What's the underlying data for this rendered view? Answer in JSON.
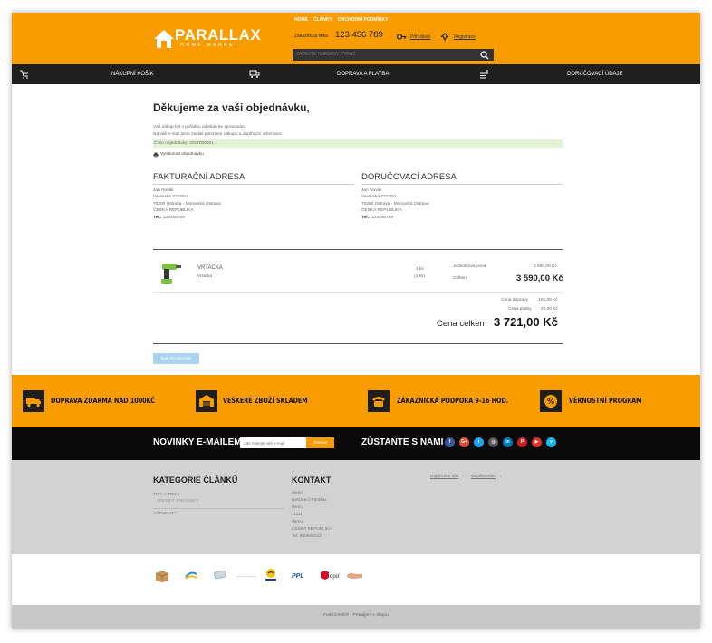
{
  "header": {
    "logo_title": "PARALLAX",
    "logo_subtitle": "HOME MARKET",
    "nav": [
      "HOME",
      "ČLÁNKY",
      "OBCHODNÍ PODMÍNKY"
    ],
    "phone_label": "Zákaznická linka",
    "phone_number": "123 456 789",
    "login": "Přihlášení",
    "register": "Registrace",
    "search_placeholder": "ZADEJTE HLEDANÝ VÝRAZ",
    "accent_color": "#f99c00"
  },
  "steps": [
    "NÁKUPNÍ KOŠÍK",
    "DOPRAVA A PLATBA",
    "DORUČOVACÍ ÚDAJE"
  ],
  "order": {
    "title": "Děkujeme za vaši objednávku,",
    "line1": "Váš nákup byl v pořádku odeslán ke zpracování.",
    "line2": "Na váš e-mail jsme zaslali potvrzení nákupu a doplňující informace.",
    "order_number": "Číslo objednávky: 2017000001",
    "print": "Vytisknout objednávku"
  },
  "billing": {
    "title": "FAKTURAČNÍ ADRESA",
    "name": "Jan Novák",
    "street": "Varenská 2723/51",
    "city": "70200 Ostrava - Moravská Ostrava",
    "country": "ČESKÁ REPUBLIKA",
    "phone_label": "Tel.:",
    "phone": "123456789"
  },
  "delivery": {
    "title": "DORUČOVACÍ ADRESA",
    "name": "Jan Novák",
    "street": "Varenská 2723/51",
    "city": "70200 Ostrava - Moravská Ostrava",
    "country": "ČESKÁ REPUBLIKA",
    "phone_label": "Tel.:",
    "phone": "123456789"
  },
  "item": {
    "name": "VRTAČKA",
    "variant": "Vrtačka",
    "qty": "1 ks",
    "qty_sub": "(1 ks)",
    "unit_label": "Jednotková cena",
    "unit_price": "3 590,00 Kč",
    "total_label": "Celkem",
    "total_price": "3 590,00 Kč"
  },
  "summary": {
    "shipping_label": "Cena dopravy",
    "shipping": "105,00 Kč",
    "payment_label": "Cena platby",
    "payment": "26,00 Kč",
    "grand_label": "Cena celkem",
    "grand": "3 721,00 Kč"
  },
  "back_button": "Zpět do obchodu",
  "features": [
    {
      "icon": "truck-icon",
      "text": "DOPRAVA ZDARMA NAD 1000KČ"
    },
    {
      "icon": "warehouse-icon",
      "text": "VEŠKERÉ ZBOŽÍ SKLADEM"
    },
    {
      "icon": "phone-icon",
      "text": "ZÁKAZNICKÁ PODPORA 9-16 HOD."
    },
    {
      "icon": "percent-icon",
      "text": "VĚRNOSTNÍ PROGRAM"
    }
  ],
  "newsletter": {
    "title": "NOVINKY E-MAILEM",
    "placeholder": "Zde zadejte váš e-mail",
    "button": "Odeslat",
    "social_title": "ZŮSTAŇTE S NÁMI"
  },
  "social": [
    {
      "name": "facebook-icon",
      "glyph": "f",
      "color": "#3b5998"
    },
    {
      "name": "google-plus-icon",
      "glyph": "G+",
      "color": "#dd4b39"
    },
    {
      "name": "twitter-icon",
      "glyph": "t",
      "color": "#1da1f2"
    },
    {
      "name": "instagram-icon",
      "glyph": "◎",
      "color": "#555555"
    },
    {
      "name": "linkedin-icon",
      "glyph": "in",
      "color": "#0077b5"
    },
    {
      "name": "pinterest-icon",
      "glyph": "P",
      "color": "#cb2027"
    },
    {
      "name": "youtube-icon",
      "glyph": "▶",
      "color": "#e52d27"
    },
    {
      "name": "vimeo-icon",
      "glyph": "v",
      "color": "#1ab7ea"
    }
  ],
  "footer": {
    "categories_title": "KATEGORIE ČLÁNKŮ",
    "cat1": "TIPY A TRIKY",
    "cat1_sub": "TRENDY A NOVINKY",
    "cat2": "AKTUALITY",
    "contact_title": "KONTAKT",
    "contact_lines": [
      "demo",
      "NetDirect Parallax",
      "demo",
      "11111",
      "demo",
      "ČESKÁ REPUBLIKA",
      "Tel: 800666222"
    ],
    "link1": "Doporučte nás",
    "link2": "Napište nám",
    "copyright": "FastCentrik® - Pronájem e-shopu"
  }
}
